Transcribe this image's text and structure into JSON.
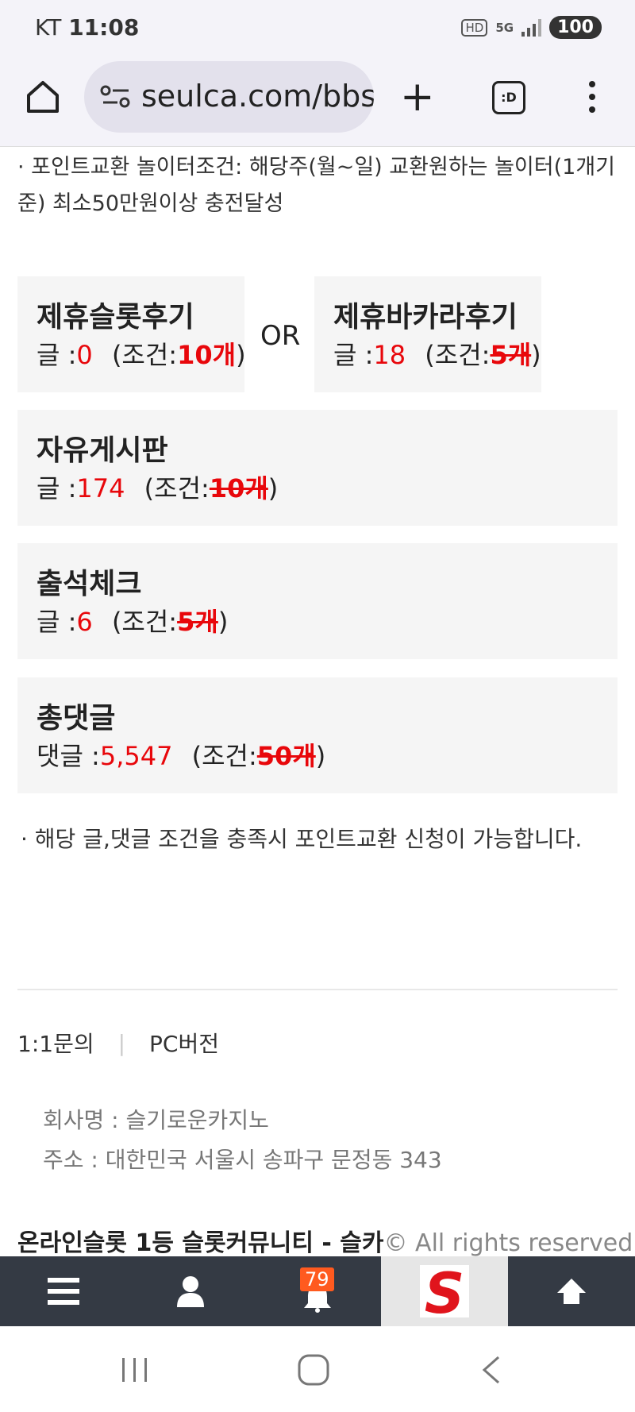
{
  "status_bar": {
    "carrier": "KT",
    "time": "11:08",
    "hd_label": "HD",
    "network": "5G",
    "battery": "100"
  },
  "browser": {
    "url": "seulca.com/bbs",
    "tabs_label": ":D"
  },
  "intro_text": "· 포인트교환 놀이터조건: 해당주(월~일) 교환원하는 놀이터(1개기준) 최소50만원이상 충전달성",
  "cards": {
    "slot_review": {
      "title": "제휴슬롯후기",
      "label": "글 :",
      "count": "0",
      "cond_prefix": "(조건:",
      "cond_value": "10개",
      "cond_suffix": ")"
    },
    "or_text": "OR",
    "baccarat_review": {
      "title": "제휴바카라후기",
      "label": "글 :",
      "count": "18",
      "cond_prefix": "(조건:",
      "cond_value": "5개",
      "cond_suffix": ")"
    },
    "free_board": {
      "title": "자유게시판",
      "label": "글 :",
      "count": "174",
      "cond_prefix": "(조건:",
      "cond_value": "10개",
      "cond_suffix": ")"
    },
    "attendance": {
      "title": "출석체크",
      "label": "글 :",
      "count": "6",
      "cond_prefix": "(조건:",
      "cond_value": "5개",
      "cond_suffix": ")"
    },
    "comments": {
      "title": "총댓글",
      "label": "댓글 :",
      "count": "5,547",
      "cond_prefix": "(조건:",
      "cond_value": "50개",
      "cond_suffix": ")"
    }
  },
  "notice_text": "· 해당 글,댓글 조건을 충족시 포인트교환 신청이 가능합니다.",
  "footer": {
    "link_inquiry": "1:1문의",
    "link_separator": "|",
    "link_pc": "PC버전",
    "company_name": "회사명 : 슬기로운카지노",
    "address": "주소 : 대한민국 서울시 송파구 문정동 343",
    "copyright_brand": "온라인슬롯 1등 슬롯커뮤니티 - 슬카",
    "copyright_rest": "© All rights reserved."
  },
  "bottom_nav": {
    "notification_count": "79",
    "logo_letter": "S",
    "items": [
      "menu-icon",
      "user-icon",
      "bell-icon",
      "site-logo",
      "arrow-up-icon"
    ]
  },
  "colors": {
    "accent_red": "#e8070b",
    "nav_bg": "#343a44",
    "badge": "#ff5a1f",
    "card_bg": "#f5f5f5"
  }
}
